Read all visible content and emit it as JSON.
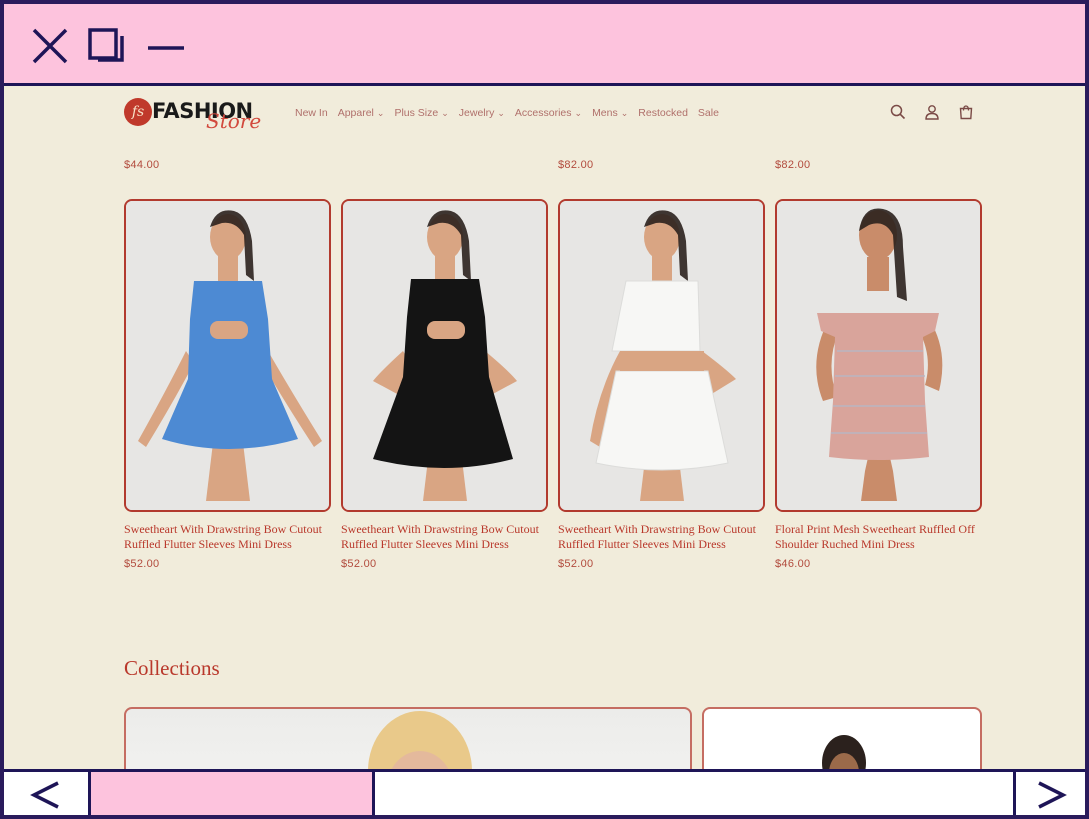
{
  "window_controls": [
    "close-icon",
    "restore-icon",
    "minimize-icon"
  ],
  "header": {
    "logo_mark": "fs",
    "logo_word": "FASHION",
    "logo_script": "Store",
    "nav": [
      {
        "label": "New In",
        "dropdown": false
      },
      {
        "label": "Apparel",
        "dropdown": true
      },
      {
        "label": "Plus Size",
        "dropdown": true
      },
      {
        "label": "Jewelry",
        "dropdown": true
      },
      {
        "label": "Accessories",
        "dropdown": true
      },
      {
        "label": "Mens",
        "dropdown": true
      },
      {
        "label": "Restocked",
        "dropdown": false
      },
      {
        "label": "Sale",
        "dropdown": false
      }
    ],
    "icons": [
      "search-icon",
      "account-icon",
      "cart-icon"
    ]
  },
  "top_prices": [
    "$44.00",
    "$82.00",
    "$82.00"
  ],
  "products": [
    {
      "title": "Sweetheart With Drawstring Bow Cutout Ruffled Flutter Sleeves Mini Dress",
      "price": "$52.00",
      "color": "#4d8ad3"
    },
    {
      "title": "Sweetheart With Drawstring Bow Cutout Ruffled Flutter Sleeves Mini Dress",
      "price": "$52.00",
      "color": "#141414"
    },
    {
      "title": "Sweetheart With Drawstring Bow Cutout Ruffled Flutter Sleeves Mini Dress",
      "price": "$52.00",
      "color": "#f7f7f5"
    },
    {
      "title": "Floral Print Mesh Sweetheart Ruffled Off Shoulder Ruched Mini Dress",
      "price": "$46.00",
      "color": "#d9a49b"
    }
  ],
  "collections_title": "Collections",
  "nav_arrows": {
    "left": "<",
    "right": ">"
  },
  "colors": {
    "accent": "#b9382b",
    "page_bg": "#f1ecdb",
    "chrome_pink": "#fdc3dd",
    "chrome_border": "#1e1557"
  }
}
